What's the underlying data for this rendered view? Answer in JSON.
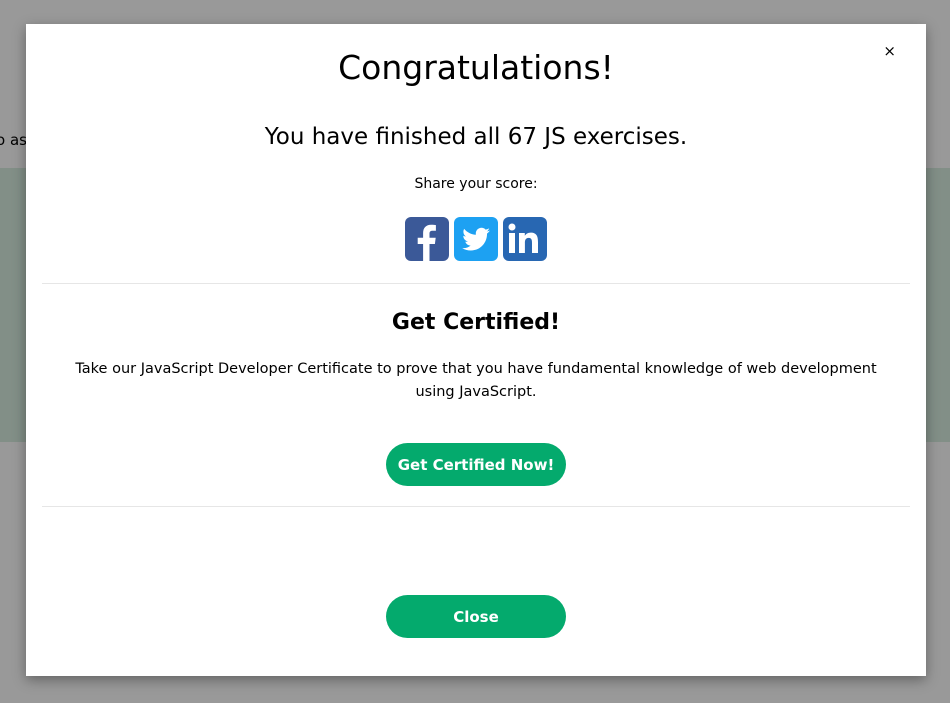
{
  "background": {
    "fragment_text": "o ass"
  },
  "modal": {
    "close_symbol": "×",
    "title": "Congratulations!",
    "subtitle": "You have finished all 67 JS exercises.",
    "share_label": "Share your score:",
    "social": [
      {
        "name": "facebook-icon",
        "color": "#3b5998"
      },
      {
        "name": "twitter-icon",
        "color": "#1da1f2"
      },
      {
        "name": "linkedin-icon",
        "color": "#0e76a8"
      }
    ],
    "cert_title": "Get Certified!",
    "cert_description": "Take our JavaScript Developer Certificate to prove that you have fundamental knowledge of web development using JavaScript.",
    "cert_button": "Get Certified Now!",
    "close_button": "Close",
    "accent_color": "#04aa6d"
  }
}
